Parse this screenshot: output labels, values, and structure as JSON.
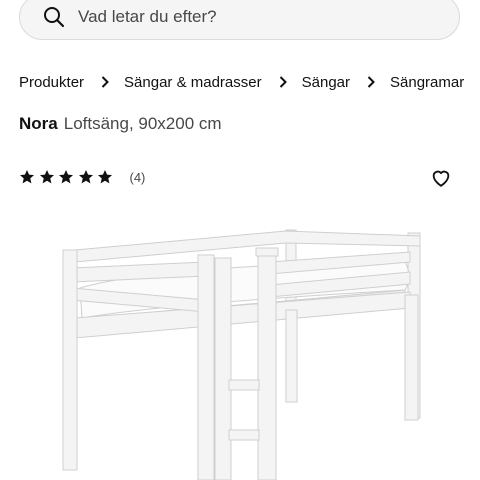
{
  "search": {
    "placeholder": "Vad letar du efter?",
    "value": ""
  },
  "breadcrumb": {
    "items": [
      {
        "label": "Produkter"
      },
      {
        "label": "Sängar & madrasser"
      },
      {
        "label": "Sängar"
      },
      {
        "label": "Sängramar"
      }
    ]
  },
  "product": {
    "name": "Nora",
    "description": "Loftsäng, 90x200 cm",
    "rating": {
      "stars": 5,
      "max_stars": 5,
      "review_count": "(4)"
    },
    "image_alt": "White loft bed"
  },
  "icons": {
    "search": "search-icon",
    "breadcrumb_separator": "chevron-right-icon",
    "star": "star-icon",
    "wishlist": "heart-icon"
  },
  "colors": {
    "text": "#111111",
    "muted": "#484848",
    "search_bg": "#f5f5f5",
    "search_border": "#dcdcdc",
    "bed": "#f4f4f4"
  }
}
